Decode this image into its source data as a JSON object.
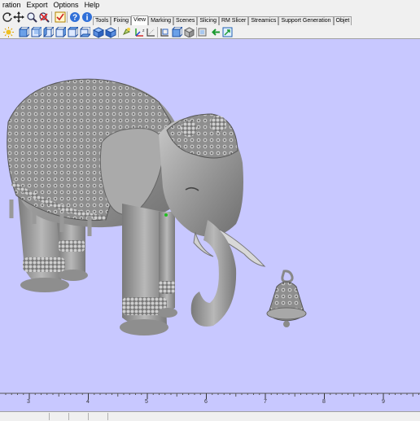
{
  "menu": [
    "ration",
    "Export",
    "Options",
    "Help"
  ],
  "tabs": [
    {
      "label": "Tools",
      "active": false
    },
    {
      "label": "Fixing",
      "active": false
    },
    {
      "label": "View",
      "active": true
    },
    {
      "label": "Marking",
      "active": false
    },
    {
      "label": "Scenes",
      "active": false
    },
    {
      "label": "Slicing",
      "active": false
    },
    {
      "label": "RM Slicer",
      "active": false
    },
    {
      "label": "Streamics",
      "active": false
    },
    {
      "label": "Support Generation",
      "active": false
    },
    {
      "label": "Objet",
      "active": false
    }
  ],
  "toolbar_main": {
    "icons": [
      "rotate-icon",
      "pan-icon",
      "zoom-in-icon",
      "zoom-out-icon",
      "checklist-icon",
      "help-icon",
      "info-icon"
    ]
  },
  "toolbar_view": {
    "icons": [
      "sun-icon",
      "view-front-icon",
      "view-back-icon",
      "view-left-icon",
      "view-right-icon",
      "view-top-icon",
      "view-bottom-icon",
      "view-iso-icon",
      "view-iso2-icon",
      "light-icon",
      "axes-icon",
      "section-icon",
      "bounding-box-icon",
      "transparency-icon",
      "import-icon",
      "export-view-icon"
    ]
  },
  "ruler": {
    "labels": [
      "3",
      "4",
      "5",
      "6",
      "7",
      "8",
      "9"
    ]
  },
  "colors": {
    "viewport": "#c8c8ff",
    "model": "#9a9a9a",
    "chrome": "#f0f0f0"
  }
}
